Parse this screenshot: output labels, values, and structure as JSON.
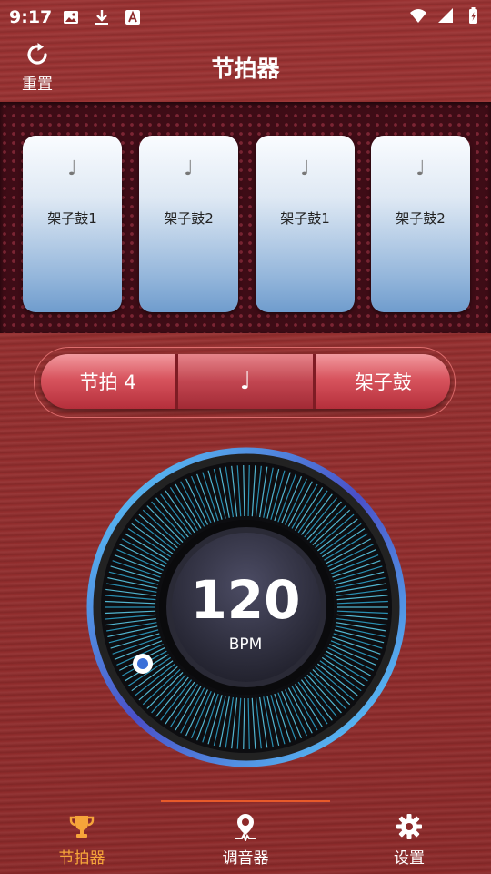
{
  "status": {
    "time": "9:17"
  },
  "header": {
    "reset_label": "重置",
    "title": "节拍器"
  },
  "pads": [
    {
      "note": "♩",
      "label": "架子鼓1"
    },
    {
      "note": "♩",
      "label": "架子鼓2"
    },
    {
      "note": "♩",
      "label": "架子鼓1"
    },
    {
      "note": "♩",
      "label": "架子鼓2"
    }
  ],
  "selector": {
    "beat": "节拍 4",
    "note": "♩",
    "sound": "架子鼓"
  },
  "dial": {
    "bpm": "120",
    "unit": "BPM"
  },
  "tabs": [
    {
      "label": "节拍器",
      "icon": "trophy-icon",
      "active": true
    },
    {
      "label": "调音器",
      "icon": "tuner-pin-icon",
      "active": false
    },
    {
      "label": "设置",
      "icon": "gear-icon",
      "active": false
    }
  ],
  "colors": {
    "accent": "#f6a53a",
    "background": "#8c2a2a",
    "dial_glow": "#48c8f0"
  }
}
